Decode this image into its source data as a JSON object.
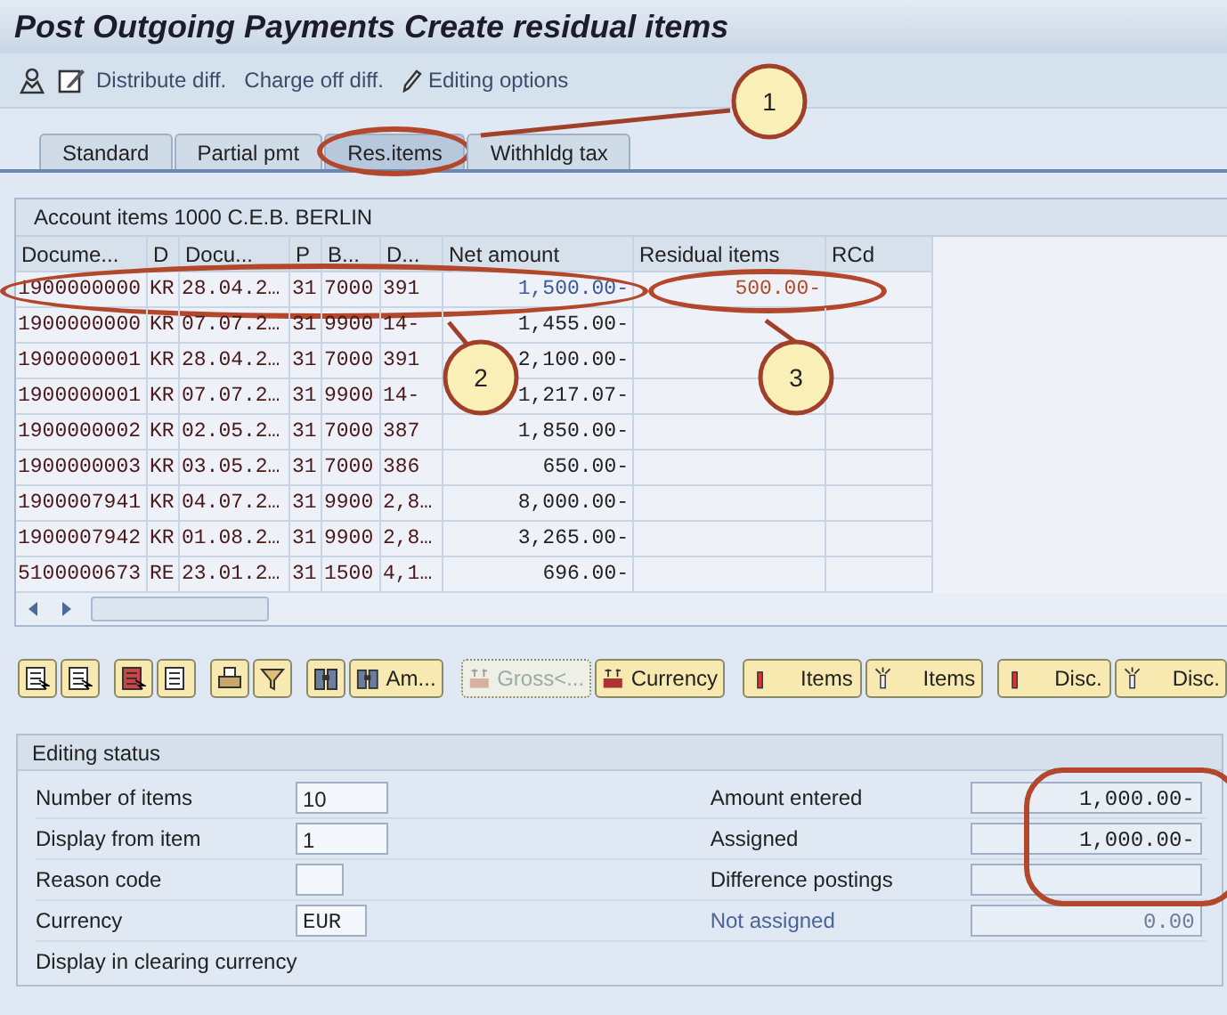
{
  "window": {
    "title": "Post Outgoing Payments Create residual items"
  },
  "toolbar": [
    {
      "kind": "person"
    },
    {
      "kind": "edit"
    },
    {
      "kind": "text",
      "label": "Distribute diff."
    },
    {
      "kind": "text",
      "label": "Charge off diff."
    },
    {
      "kind": "pencil",
      "label": "Editing options"
    }
  ],
  "tabs": [
    {
      "label": "Standard",
      "selected": false,
      "highlighted": false
    },
    {
      "label": "Partial pmt",
      "selected": false,
      "highlighted": false
    },
    {
      "label": "Res.items",
      "selected": true,
      "highlighted": true
    },
    {
      "label": "Withhldg tax",
      "selected": false,
      "highlighted": false
    }
  ],
  "table": {
    "title": "Account items 1000 C.E.B. BERLIN",
    "columns": [
      "Docume...",
      "D",
      "Docu...",
      "P",
      "B...",
      "D...",
      "Net amount",
      "Residual items",
      "RCd"
    ],
    "rows": [
      {
        "cells": [
          "1900000000",
          "KR",
          "28.04.2…",
          "31",
          "7000",
          "391",
          "1,500.00-",
          "500.00-",
          ""
        ],
        "selected": true,
        "highlighted": true
      },
      {
        "cells": [
          "1900000000",
          "KR",
          "07.07.2…",
          "31",
          "9900",
          "14-",
          "1,455.00-",
          "",
          ""
        ],
        "selected": false,
        "highlighted": false
      },
      {
        "cells": [
          "1900000001",
          "KR",
          "28.04.2…",
          "31",
          "7000",
          "391",
          "2,100.00-",
          "",
          ""
        ],
        "selected": false,
        "highlighted": false
      },
      {
        "cells": [
          "1900000001",
          "KR",
          "07.07.2…",
          "31",
          "9900",
          "14-",
          "1,217.07-",
          "",
          ""
        ],
        "selected": false,
        "highlighted": false
      },
      {
        "cells": [
          "1900000002",
          "KR",
          "02.05.2…",
          "31",
          "7000",
          "387",
          "1,850.00-",
          "",
          ""
        ],
        "selected": false,
        "highlighted": false
      },
      {
        "cells": [
          "1900000003",
          "KR",
          "03.05.2…",
          "31",
          "7000",
          "386",
          "650.00-",
          "",
          ""
        ],
        "selected": false,
        "highlighted": false
      },
      {
        "cells": [
          "1900007941",
          "KR",
          "04.07.2…",
          "31",
          "9900",
          "2,8…",
          "8,000.00-",
          "",
          ""
        ],
        "selected": false,
        "highlighted": false
      },
      {
        "cells": [
          "1900007942",
          "KR",
          "01.08.2…",
          "31",
          "9900",
          "2,8…",
          "3,265.00-",
          "",
          ""
        ],
        "selected": false,
        "highlighted": false
      },
      {
        "cells": [
          "5100000673",
          "RE",
          "23.01.2…",
          "31",
          "1500",
          "4,1…",
          "696.00-",
          "",
          ""
        ],
        "selected": false,
        "highlighted": false
      }
    ]
  },
  "buttons": [
    {
      "kind": "select"
    },
    {
      "kind": "deselect"
    },
    {
      "kind": "list"
    },
    {
      "kind": "list2"
    },
    {
      "kind": "print"
    },
    {
      "kind": "filter"
    },
    {
      "kind": "find"
    },
    {
      "kind": "find",
      "label": "Am..."
    },
    {
      "kind": "money",
      "label": "Gross<...",
      "disabled": true
    },
    {
      "kind": "money",
      "label": "Currency",
      "disabled": false
    },
    {
      "kind": "on",
      "label": "Items"
    },
    {
      "kind": "off",
      "label": "Items"
    },
    {
      "kind": "on",
      "label": "Disc."
    },
    {
      "kind": "off",
      "label": "Disc."
    }
  ],
  "editing_status": {
    "title": "Editing status",
    "left": [
      {
        "kind": "field",
        "label": "Number of items",
        "value": "10"
      },
      {
        "kind": "field",
        "label": "Display from item",
        "value": "1"
      },
      {
        "kind": "field",
        "label": "Reason code"
      },
      {
        "kind": "field",
        "label": "Currency",
        "value": "EUR"
      },
      {
        "kind": "checkbox_label",
        "label": "Display in clearing currency"
      }
    ],
    "right": [
      {
        "kind": "field",
        "label": "Amount entered",
        "value": "1,000.00-"
      },
      {
        "kind": "field",
        "label": "Assigned",
        "value": "1,000.00-"
      },
      {
        "kind": "field",
        "label": "Difference postings"
      },
      {
        "kind": "total",
        "label": "Not assigned",
        "value": "0.00"
      }
    ],
    "amounts_highlighted": true
  },
  "callouts": [
    {
      "label": "1"
    },
    {
      "label": "2"
    },
    {
      "label": "3"
    }
  ]
}
